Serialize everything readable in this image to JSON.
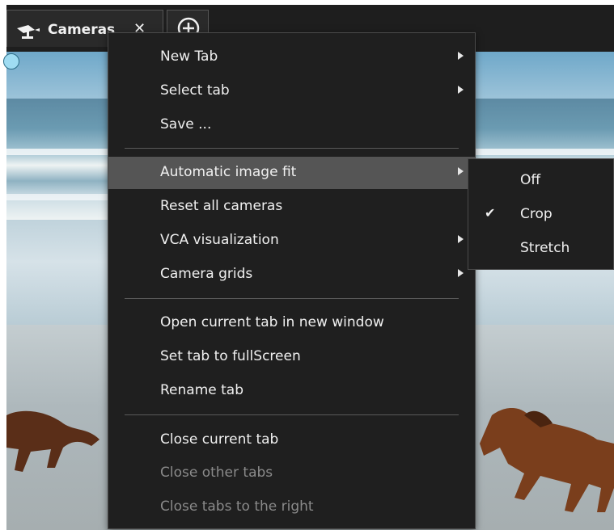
{
  "tabbar": {
    "camera_tab": {
      "label": "Cameras",
      "close_glyph": "✕",
      "icon": "camera-icon"
    },
    "add_tab": {
      "icon": "add-circle-icon"
    }
  },
  "video": {
    "status_dot_color": "#9fdcf2"
  },
  "context_menu": {
    "items": [
      {
        "label": "New Tab",
        "submenu": true
      },
      {
        "label": "Select tab",
        "submenu": true
      },
      {
        "label": "Save ...",
        "submenu": false
      },
      {
        "label": "Automatic image fit",
        "submenu": true,
        "highlighted": true
      },
      {
        "label": "Reset all cameras",
        "submenu": false
      },
      {
        "label": "VCA visualization",
        "submenu": true
      },
      {
        "label": "Camera grids",
        "submenu": true
      },
      {
        "label": "Open current tab in new window",
        "submenu": false
      },
      {
        "label": "Set tab to fullScreen",
        "submenu": false
      },
      {
        "label": "Rename tab",
        "submenu": false
      },
      {
        "label": "Close current tab",
        "submenu": false
      },
      {
        "label": "Close other tabs",
        "submenu": false,
        "disabled": true
      },
      {
        "label": "Close tabs to the right",
        "submenu": false,
        "disabled": true
      }
    ]
  },
  "image_fit_submenu": {
    "options": [
      {
        "label": "Off",
        "checked": false
      },
      {
        "label": "Crop",
        "checked": true
      },
      {
        "label": "Stretch",
        "checked": false
      }
    ],
    "check_glyph": "✔"
  },
  "colors": {
    "menu_bg": "#1f1f1f",
    "highlight_bg": "#555555",
    "text": "#f0f0f0",
    "disabled_text": "#8a8a8a"
  }
}
